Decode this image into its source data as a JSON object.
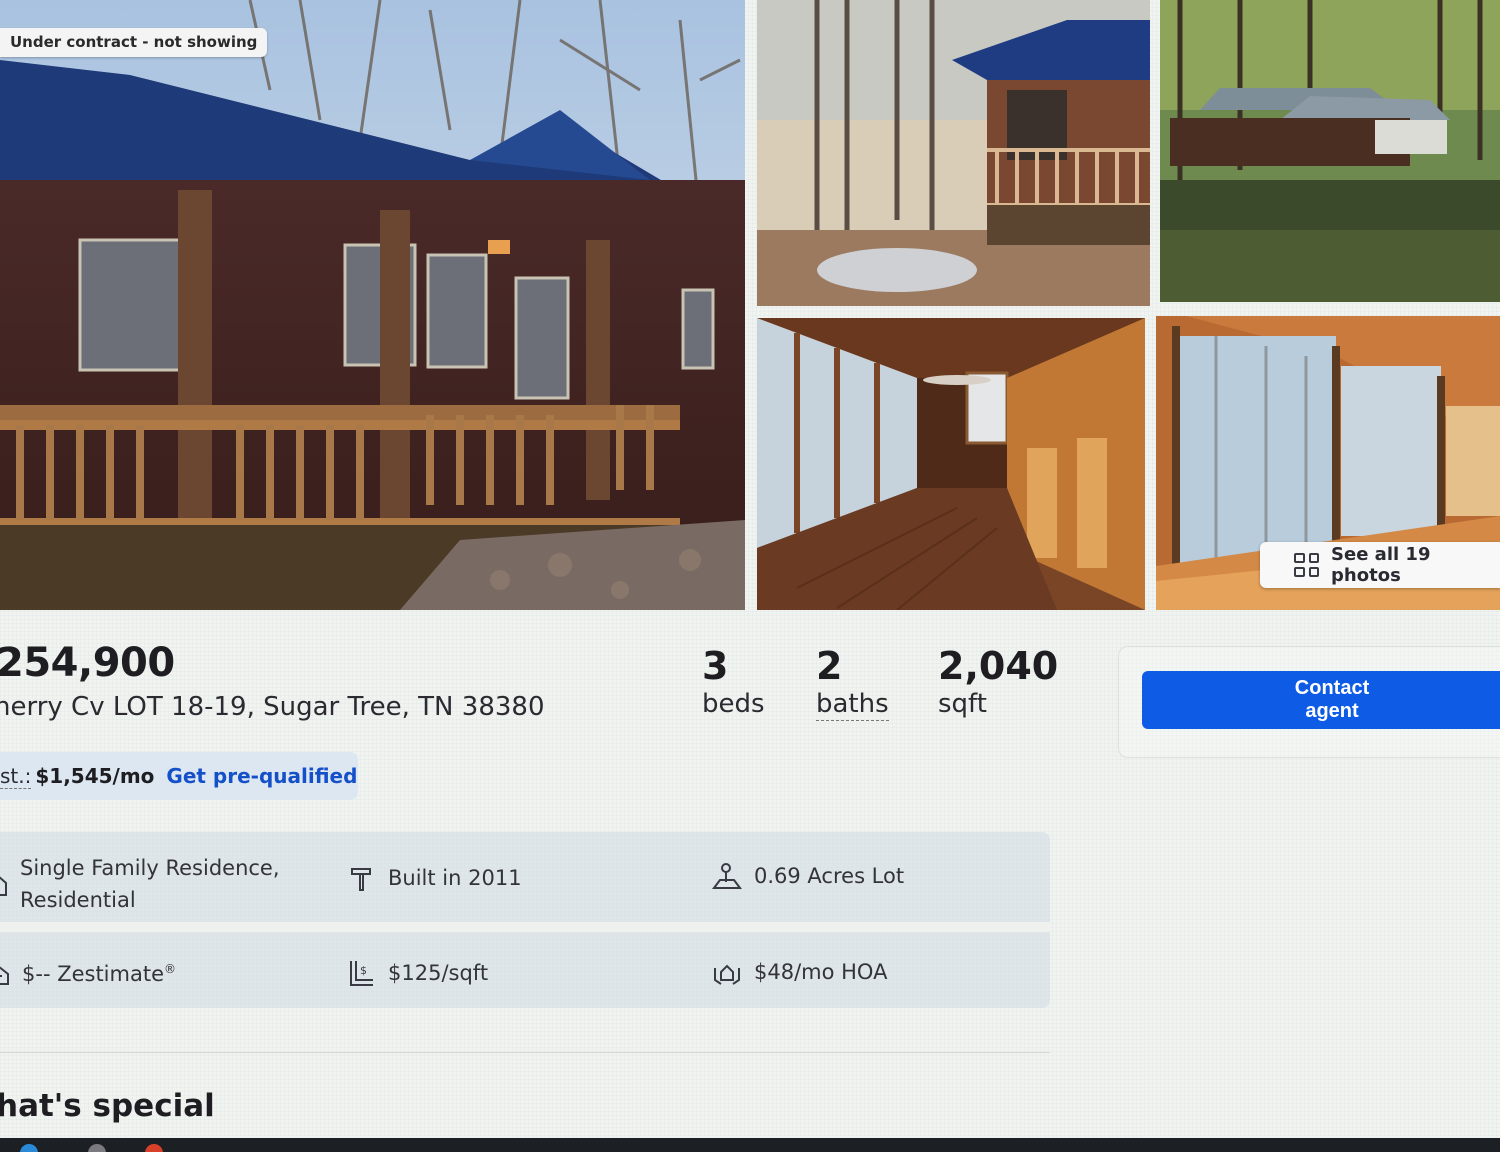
{
  "gallery": {
    "status_badge": "Under contract - not showing",
    "see_all_label": "See all 19 photos"
  },
  "summary": {
    "price": "254,900",
    "address": "herry Cv LOT 18-19, Sugar Tree, TN 38380",
    "beds_value": "3",
    "beds_label": "beds",
    "baths_value": "2",
    "baths_label": "baths",
    "sqft_value": "2,040",
    "sqft_label": "sqft"
  },
  "contact": {
    "button_label": "Contact agent",
    "color": "#0e5ce6"
  },
  "estimate": {
    "label": "st.:",
    "value": "$1,545/mo",
    "link": "Get pre-qualified"
  },
  "facts": {
    "type": "Single Family Residence, Residential",
    "type_icon": "house-icon",
    "built": "Built in 2011",
    "built_icon": "hammer-icon",
    "lot": "0.69 Acres Lot",
    "lot_icon": "lot-icon",
    "zestimate": "$-- Zestimate",
    "zestimate_mark": "®",
    "zestimate_icon": "home-value-icon",
    "price_per_sqft": "$125/sqft",
    "price_per_sqft_icon": "price-sqft-icon",
    "hoa": "$48/mo HOA",
    "hoa_icon": "hoa-icon"
  },
  "section": {
    "heading": "hat's special"
  }
}
